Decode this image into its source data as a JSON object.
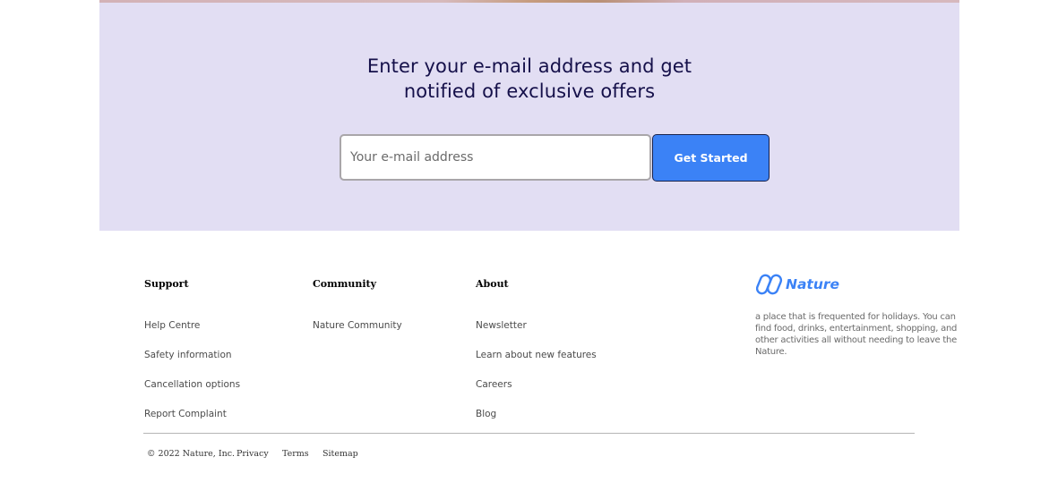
{
  "newsletter": {
    "title_line1": "Enter your e-mail address and get",
    "title_line2": "notified of exclusive offers",
    "email_placeholder": "Your e-mail address",
    "button_label": "Get Started"
  },
  "footer": {
    "columns": [
      {
        "heading": "Support",
        "links": [
          "Help Centre",
          "Safety information",
          "Cancellation options",
          "Report Complaint"
        ]
      },
      {
        "heading": "Community",
        "links": [
          "Nature Community"
        ]
      },
      {
        "heading": "About",
        "links": [
          "Newsletter",
          "Learn about new features",
          "Careers",
          "Blog"
        ]
      }
    ],
    "brand": {
      "name": "Nature",
      "icon": "nature-logo-icon",
      "description": "a place that is frequented for holidays. You can find food, drinks, entertainment, shopping, and other activities all without needing to leave the Nature."
    },
    "bottom": {
      "copyright": "© 2022 Nature, Inc.",
      "links": [
        "Privacy",
        "Terms",
        "Sitemap"
      ]
    }
  },
  "colors": {
    "accent": "#3b82f6",
    "newsletter_bg": "#e2def3",
    "title": "#15104a"
  }
}
